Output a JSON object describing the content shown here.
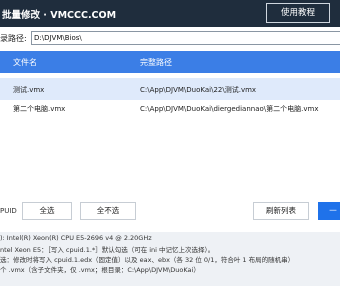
{
  "header": {
    "title": "批量修改 · VMCCC.COM",
    "tutorial_button": "使用教程"
  },
  "path": {
    "label": "录路径:",
    "value": "D:\\DJVM\\Bios\\"
  },
  "table": {
    "columns": [
      "文件名",
      "完整路径"
    ],
    "rows": [
      {
        "name": "测试.vmx",
        "path": "C:\\App\\DJVM\\DuoKai\\22\\测试.vmx"
      },
      {
        "name": "第二个电脑.vmx",
        "path": "C:\\App\\DJVM\\DuoKai\\diergediannao\\第二个电脑.vmx"
      }
    ]
  },
  "actions": {
    "uid_label": "PUID",
    "select_all": "全选",
    "select_none": "全不选",
    "refresh": "刷新列表",
    "primary": "一"
  },
  "info": {
    "line1": "): Intel(R) Xeon(R) CPU E5-2696 v4 @ 2.20GHz",
    "line2": "ntel Xeon E5：［写入 cpuid.1.*］默认勾选（可在 ini 中记忆上次选择）。",
    "line3": "选：修改时将写入 cpuid.1.edx（固定值）以及 eax、ebx（各 32 位 0/1，符合叶 1 布局的随机串）",
    "line4": "个 .vmx（含子文件夹，仅 .vmx；根目录：C:\\App\\DJVM\\DuoKai）"
  }
}
